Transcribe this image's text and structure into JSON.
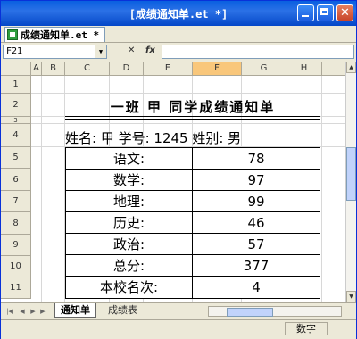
{
  "window": {
    "title": "[成绩通知单.et *]"
  },
  "doc_tab": {
    "label": "成绩通知单.et *"
  },
  "formula_bar": {
    "cell_ref": "F21",
    "cancel_icon": "✕",
    "fx_label": "fx"
  },
  "columns": [
    "A",
    "B",
    "C",
    "D",
    "E",
    "F",
    "G",
    "H"
  ],
  "selected_column": "F",
  "rows": [
    "1",
    "2",
    "3",
    "4",
    "5",
    "6",
    "7",
    "8",
    "9",
    "10",
    "11"
  ],
  "sheet": {
    "title": "一班 甲 同学成绩通知单",
    "info": "姓名: 甲 学号: 1245 姓别: 男",
    "table": [
      {
        "label": "语文:",
        "value": "78"
      },
      {
        "label": "数学:",
        "value": "97"
      },
      {
        "label": "地理:",
        "value": "99"
      },
      {
        "label": "历史:",
        "value": "46"
      },
      {
        "label": "政治:",
        "value": "57"
      },
      {
        "label": "总分:",
        "value": "377"
      },
      {
        "label": "本校名次:",
        "value": "4"
      }
    ]
  },
  "sheet_tabs": [
    "通知单",
    "成绩表"
  ],
  "status": {
    "mode": "数字"
  }
}
